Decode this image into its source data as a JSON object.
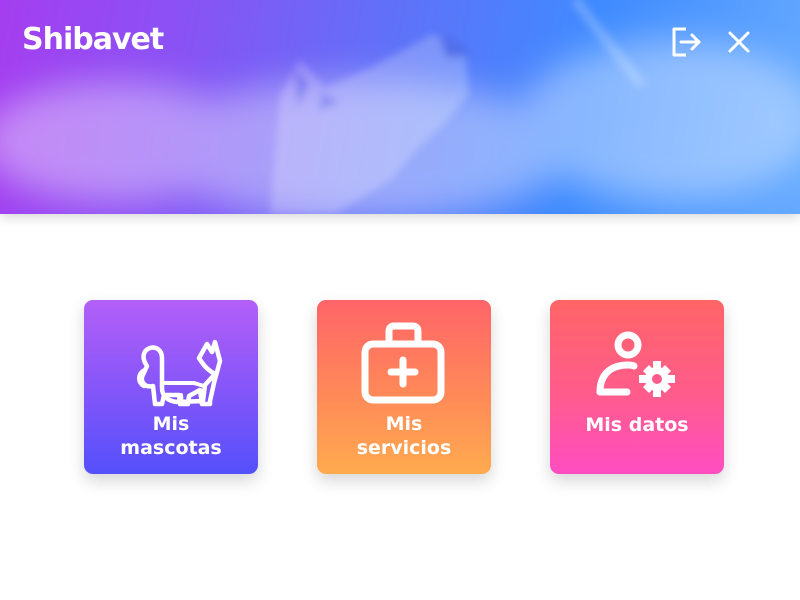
{
  "header": {
    "app_title": "Shibavet",
    "actions": [
      {
        "name": "logout",
        "icon": "logout-icon"
      },
      {
        "name": "close",
        "icon": "close-icon"
      }
    ]
  },
  "tiles": [
    {
      "label_lines": [
        "Mis",
        "mascotas"
      ],
      "icon": "dog-icon",
      "gradient": [
        "#b35ff8",
        "#5550fb"
      ]
    },
    {
      "label_lines": [
        "Mis",
        "servicios"
      ],
      "icon": "medical-kit-icon",
      "gradient": [
        "#ff6468",
        "#ffaa4f"
      ]
    },
    {
      "label_lines": [
        "Mis datos"
      ],
      "icon": "user-settings-icon",
      "gradient": [
        "#ff6466",
        "#ff4dc2"
      ]
    }
  ],
  "colors": {
    "header_gradient_start": "#a53ef0",
    "header_gradient_end": "#66aaff",
    "text": "#ffffff"
  }
}
